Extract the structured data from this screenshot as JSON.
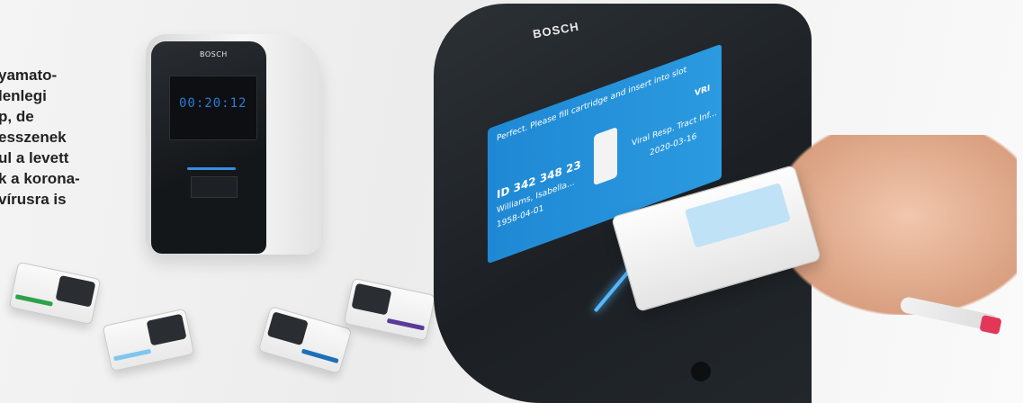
{
  "caption": {
    "lines": [
      "yamato-",
      "lenlegi",
      "p, de",
      "esszenek",
      "ul a levett",
      "k a korona-",
      "vírusra is"
    ]
  },
  "small_device": {
    "brand": "BOSCH",
    "timer": "00:20:12"
  },
  "large_device": {
    "brand": "BOSCH",
    "screen": {
      "instruction": "Perfect. Please fill cartridge and insert into slot",
      "id": "ID 342 348 23",
      "patient": "Williams, Isabella...",
      "dob": "1958-04-01",
      "test": "Viral Resp. Tract Inf...",
      "code": "VRI",
      "date": "2020-03-16"
    }
  },
  "colors": {
    "accent_blue": "#1f88d4",
    "device_dark": "#1c2024",
    "cap_red": "#e3375a"
  }
}
